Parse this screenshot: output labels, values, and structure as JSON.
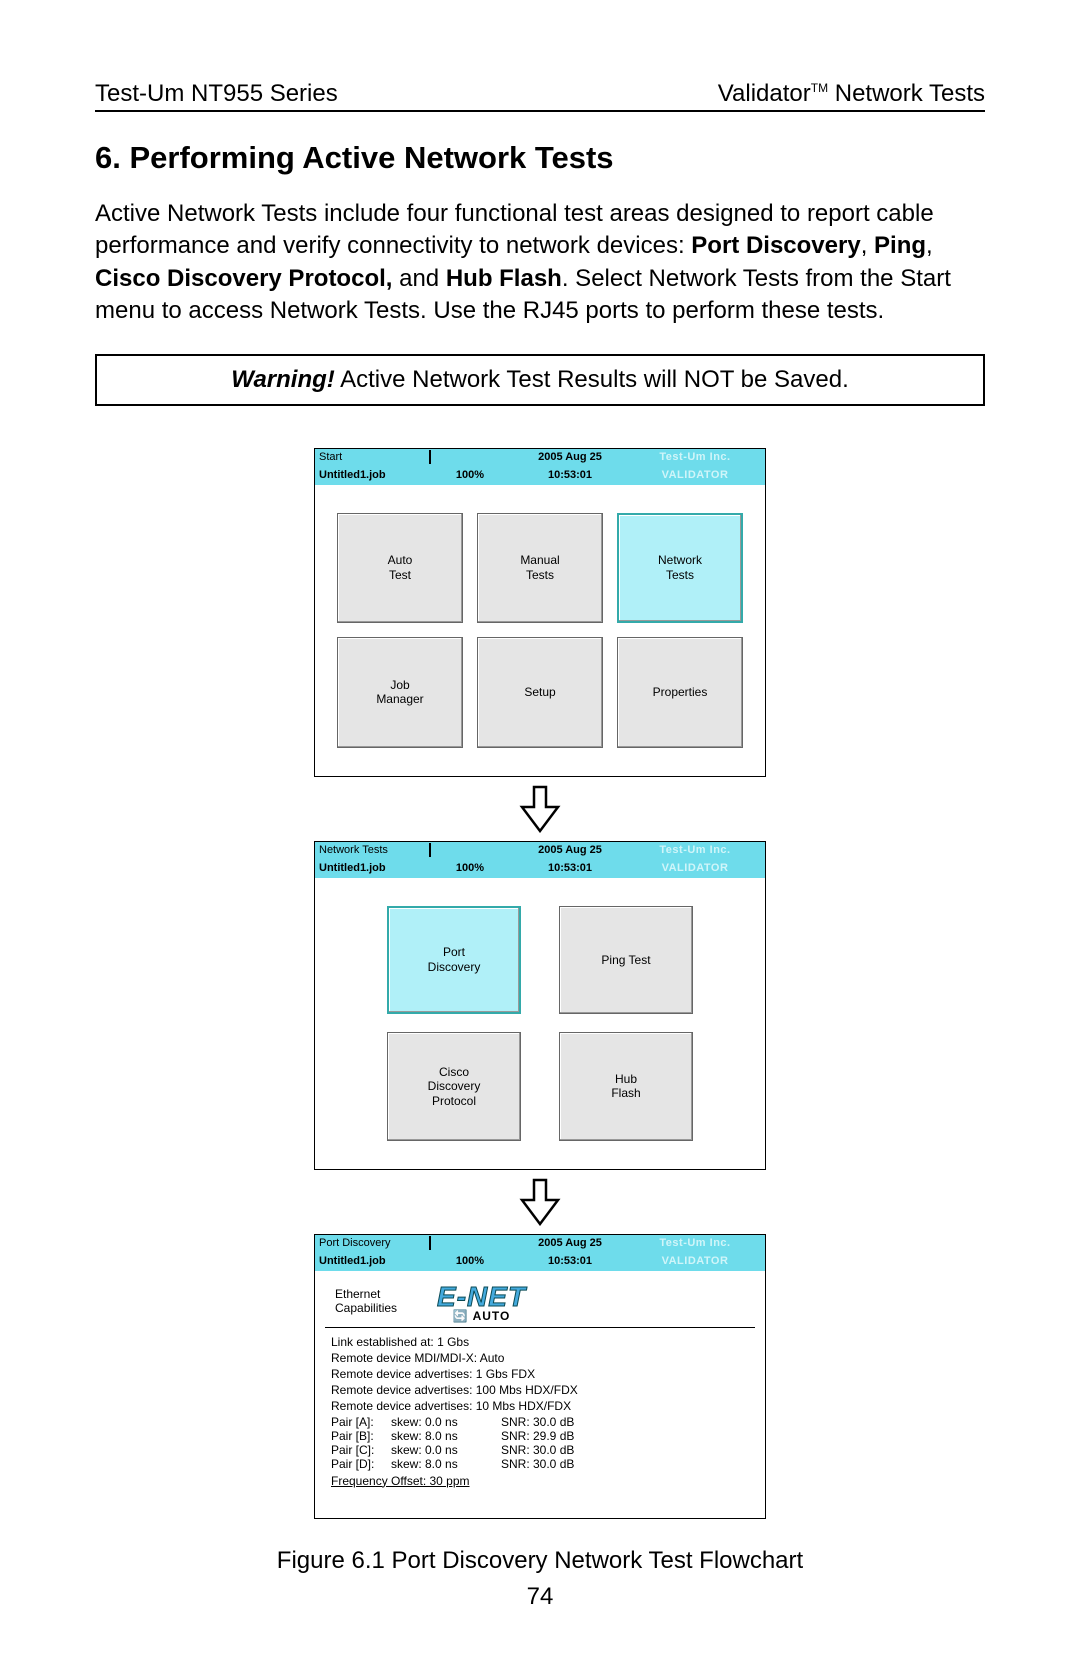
{
  "header": {
    "left": "Test-Um NT955 Series",
    "right_prefix": "Validator",
    "right_tm": "TM",
    "right_suffix": " Network Tests"
  },
  "section_title": "6. Performing Active Network Tests",
  "body": {
    "p1_a": "Active Network Tests include four functional test areas designed to report cable performance and verify connectivity to network devices:  ",
    "p1_b1": "Port Discovery",
    "p1_sep1": ", ",
    "p1_b2": "Ping",
    "p1_sep2": ", ",
    "p1_b3": "Cisco Discovery Protocol,",
    "p1_sep3": "  and ",
    "p1_b4": "Hub Flash",
    "p1_c": ".  Select Network Tests from the Start menu to access Network Tests. Use the RJ45 ports to perform these tests."
  },
  "warning": {
    "label": "Warning!",
    "text": " Active Network Test Results will NOT be Saved."
  },
  "screen1": {
    "title": "Start",
    "job": "Untitled1.job",
    "pct": "100%",
    "date": "2005 Aug 25",
    "time": "10:53:01",
    "brand": "Test-Um Inc.",
    "brand2": "VALIDATOR",
    "buttons": [
      "Auto\nTest",
      "Manual\nTests",
      "Network\nTests",
      "Job\nManager",
      "Setup",
      "Properties"
    ]
  },
  "screen2": {
    "title": "Network Tests",
    "job": "Untitled1.job",
    "pct": "100%",
    "date": "2005 Aug 25",
    "time": "10:53:01",
    "brand": "Test-Um Inc.",
    "brand2": "VALIDATOR",
    "buttons": [
      "Port\nDiscovery",
      "Ping Test",
      "Cisco\nDiscovery\nProtocol",
      "Hub\nFlash"
    ]
  },
  "screen3": {
    "title": "Port Discovery",
    "job": "Untitled1.job",
    "pct": "100%",
    "date": "2005 Aug 25",
    "time": "10:53:01",
    "brand": "Test-Um Inc.",
    "brand2": "VALIDATOR",
    "eth_label": "Ethernet\nCapabilities",
    "enet": "E-NET",
    "enet_sub": "AUTO",
    "lines": [
      "Link established at: 1 Gbs",
      "Remote device MDI/MDI-X: Auto",
      "Remote device advertises:   1 Gbs FDX",
      "Remote device advertises: 100 Mbs HDX/FDX",
      "Remote device advertises:   10 Mbs HDX/FDX"
    ],
    "pairs": [
      {
        "p": "Pair [A]:",
        "skew": "skew: 0.0 ns",
        "snr": "SNR: 30.0 dB"
      },
      {
        "p": "Pair [B]:",
        "skew": "skew: 8.0 ns",
        "snr": "SNR: 29.9 dB"
      },
      {
        "p": "Pair [C]:",
        "skew": "skew: 0.0 ns",
        "snr": "SNR: 30.0 dB"
      },
      {
        "p": "Pair [D]:",
        "skew": "skew: 8.0 ns",
        "snr": "SNR: 30.0 dB"
      }
    ],
    "freq": "Frequency Offset: 30 ppm"
  },
  "figure_caption": "Figure 6.1 Port Discovery Network Test Flowchart",
  "page_number": "74"
}
